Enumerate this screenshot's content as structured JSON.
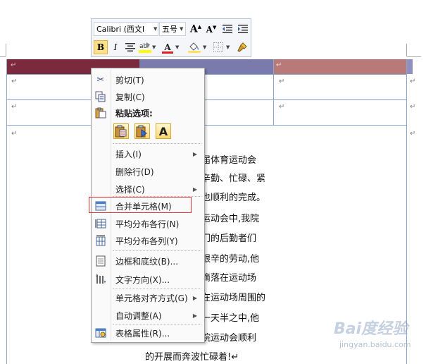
{
  "colors": {
    "header_dark_red": "#7a2a3c",
    "header_slate": "#7a7aac",
    "header_rose": "#b87a78",
    "table_border": "#8aa6c8",
    "highlight_border": "#e03030"
  },
  "toolbar": {
    "font_name": "Calibri (西文I",
    "font_size": "五号",
    "grow_font_glyph": "A",
    "shrink_font_glyph": "A",
    "bold_glyph": "B",
    "italic_glyph": "I",
    "font_color_glyph": "A",
    "icons": [
      "grow-font-icon",
      "shrink-font-icon",
      "decrease-indent-icon",
      "increase-indent-icon",
      "bold-icon",
      "italic-icon",
      "center-align-icon",
      "highlight-icon",
      "font-color-icon",
      "shading-icon",
      "borders-icon",
      "format-painter-icon"
    ]
  },
  "table": {
    "paragraph_mark": "↵"
  },
  "context_menu": {
    "items": [
      {
        "label": "剪切(T)",
        "icon": "scissors-icon"
      },
      {
        "label": "复制(C)",
        "icon": "copy-icon"
      },
      {
        "label": "粘贴选项:",
        "icon": "paste-icon"
      },
      {
        "label": "插入(I)",
        "icon": "",
        "submenu": true
      },
      {
        "label": "删除行(D)",
        "icon": ""
      },
      {
        "label": "选择(C)",
        "icon": "",
        "submenu": true
      },
      {
        "label": "合并单元格(M)",
        "icon": "merge-cells-icon"
      },
      {
        "label": "平均分布各行(N)",
        "icon": "distribute-rows-icon"
      },
      {
        "label": "平均分布各列(Y)",
        "icon": "distribute-columns-icon"
      },
      {
        "label": "边框和底纹(B)...",
        "icon": "borders-shading-icon"
      },
      {
        "label": "文字方向(X)...",
        "icon": "text-direction-icon"
      },
      {
        "label": "单元格对齐方式(G)",
        "icon": "",
        "submenu": true
      },
      {
        "label": "自动调整(A)",
        "icon": "",
        "submenu": true
      },
      {
        "label": "表格属性(R)...",
        "icon": "table-properties-icon"
      }
    ],
    "paste_options": [
      "paste-keep-formatting-icon",
      "paste-merge-formatting-icon",
      "paste-text-only-icon"
    ],
    "paste_text_only_glyph": "A",
    "submenu_arrow": "▶"
  },
  "document": {
    "lines": [
      "届体育运动会",
      "辛勤、忙碌、紧",
      "也顺利的完成。",
      "运动会中,我院",
      "门的后勤者们",
      "艰辛的劳动,他",
      "滴落在运动场",
      "在运动场周围的",
      "一天半之中,他",
      "院运动会顺利"
    ],
    "last_line": "的开展而奔波忙碌着!↵"
  },
  "watermark": {
    "brand": "Bai度经验",
    "url": "jingyan.baidu.com"
  }
}
